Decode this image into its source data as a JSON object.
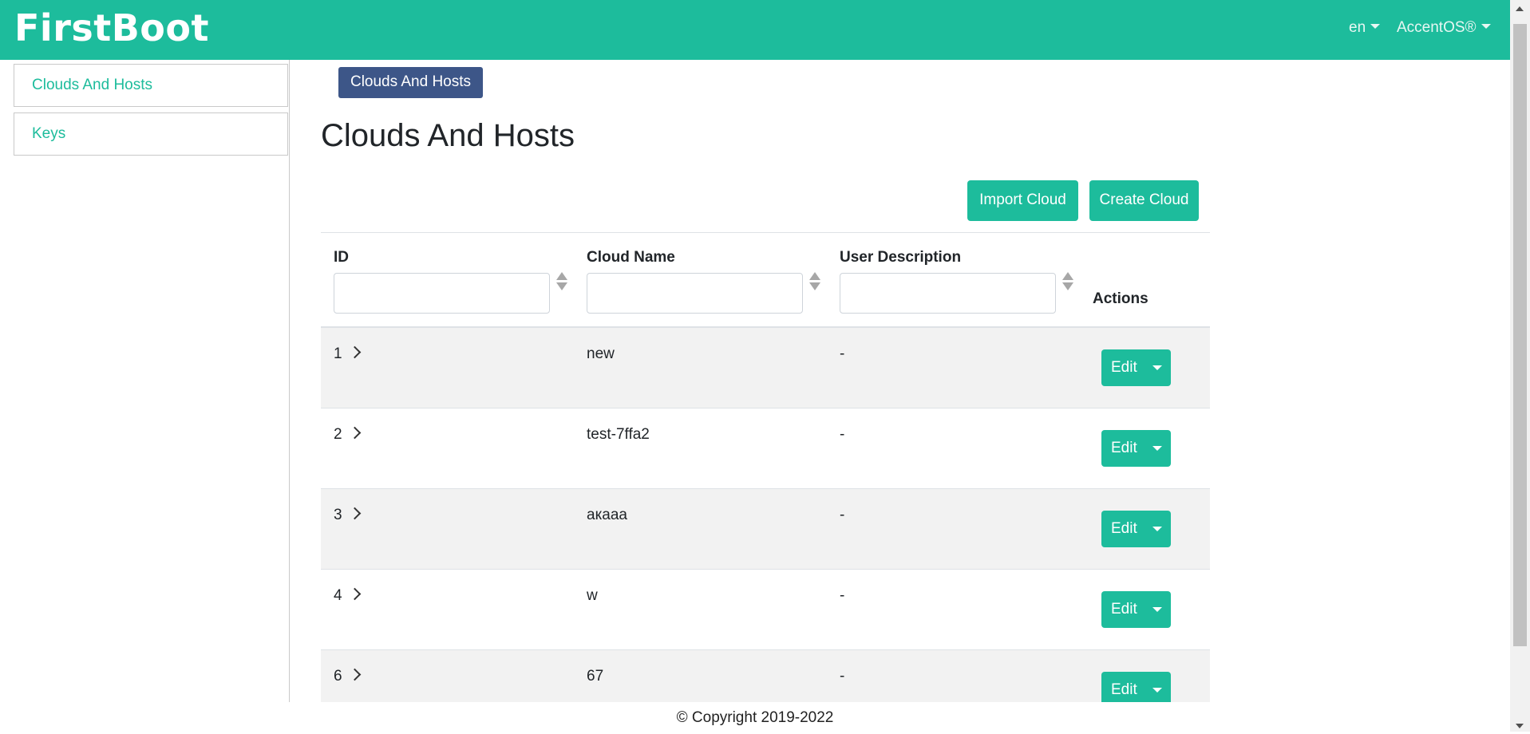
{
  "header": {
    "brand": "FirstBoot",
    "language": "en",
    "user_menu": "AccentOS®"
  },
  "colors": {
    "primary": "#1dbc9c",
    "breadcrumb": "#3d5688",
    "row_alt": "#f2f2f2"
  },
  "sidebar": {
    "items": [
      {
        "label": "Clouds And Hosts"
      },
      {
        "label": "Keys"
      }
    ]
  },
  "breadcrumb": "Clouds And Hosts",
  "page_title": "Clouds And Hosts",
  "toolbar": {
    "import_label": "Import Cloud",
    "create_label": "Create Cloud"
  },
  "table": {
    "columns": {
      "id": "ID",
      "name": "Cloud Name",
      "description": "User Description",
      "actions": "Actions"
    },
    "filters": {
      "id": "",
      "name": "",
      "description": ""
    },
    "rows": [
      {
        "id": "1",
        "name": "new",
        "description": "-",
        "action": "Edit"
      },
      {
        "id": "2",
        "name": "test-7ffa2",
        "description": "-",
        "action": "Edit"
      },
      {
        "id": "3",
        "name": "акааа",
        "description": "-",
        "action": "Edit"
      },
      {
        "id": "4",
        "name": "w",
        "description": "-",
        "action": "Edit"
      },
      {
        "id": "6",
        "name": "67",
        "description": "-",
        "action": "Edit"
      }
    ]
  },
  "footer": "© Copyright 2019-2022"
}
